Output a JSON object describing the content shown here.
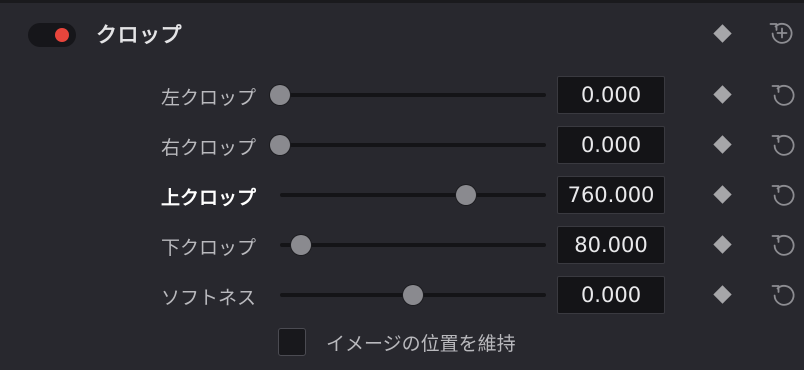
{
  "header": {
    "title": "クロップ",
    "enabled": true,
    "toggle_color": "#e8453c"
  },
  "rows": [
    {
      "label": "左クロップ",
      "value": "0.000",
      "slider_fraction": 0.0
    },
    {
      "label": "右クロップ",
      "value": "0.000",
      "slider_fraction": 0.0
    },
    {
      "label": "上クロップ",
      "value": "760.000",
      "slider_fraction": 0.7
    },
    {
      "label": "下クロップ",
      "value": "80.000",
      "slider_fraction": 0.08
    },
    {
      "label": "ソフトネス",
      "value": "0.000",
      "slider_fraction": 0.5
    }
  ],
  "checkbox": {
    "label": "イメージの位置を維持",
    "checked": false
  },
  "icons": {
    "keyframe": "keyframe-diamond-icon",
    "reset": "reset-icon",
    "reset_all": "reset-all-icon"
  }
}
